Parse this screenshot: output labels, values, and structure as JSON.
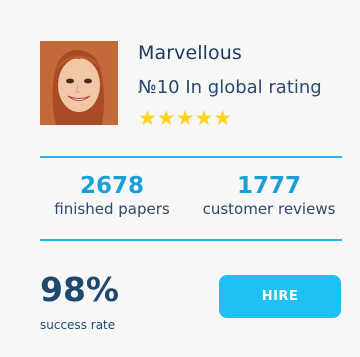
{
  "profile": {
    "name": "Marvellous",
    "rank_text": "№10 In global rating",
    "rating_stars": 5,
    "stars_text": "★★★★★"
  },
  "stats": [
    {
      "value": "2678",
      "label": "finished papers"
    },
    {
      "value": "1777",
      "label": "customer reviews"
    }
  ],
  "success": {
    "value": "98%",
    "label": "success rate"
  },
  "actions": {
    "hire_label": "HIRE"
  },
  "colors": {
    "accent": "#1fc0f4",
    "divider": "#22b4ee",
    "stat_number": "#1a9fd9",
    "text_dark": "#1d4870",
    "star": "#ffd21e"
  }
}
